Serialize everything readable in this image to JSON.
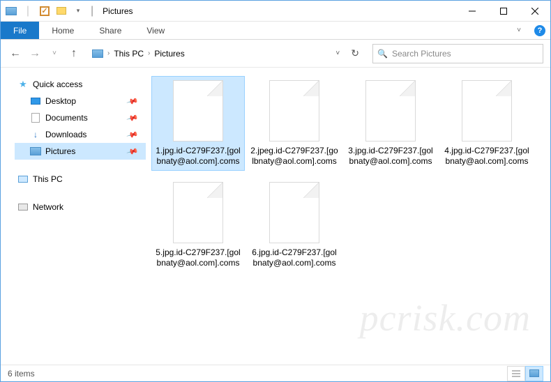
{
  "window": {
    "title": "Pictures"
  },
  "ribbon": {
    "file": "File",
    "tabs": [
      "Home",
      "Share",
      "View"
    ]
  },
  "breadcrumb": {
    "root": "This PC",
    "current": "Pictures"
  },
  "search": {
    "placeholder": "Search Pictures"
  },
  "sidebar": {
    "quick": "Quick access",
    "items": [
      {
        "label": "Desktop",
        "pinned": true
      },
      {
        "label": "Documents",
        "pinned": true
      },
      {
        "label": "Downloads",
        "pinned": true
      },
      {
        "label": "Pictures",
        "pinned": true,
        "selected": true
      }
    ],
    "thispc": "This PC",
    "network": "Network"
  },
  "files": [
    {
      "name": "1.jpg.id-C279F237.[golbnaty@aol.com].coms",
      "selected": true
    },
    {
      "name": "2.jpeg.id-C279F237.[golbnaty@aol.com].coms"
    },
    {
      "name": "3.jpg.id-C279F237.[golbnaty@aol.com].coms"
    },
    {
      "name": "4.jpg.id-C279F237.[golbnaty@aol.com].coms"
    },
    {
      "name": "5.jpg.id-C279F237.[golbnaty@aol.com].coms"
    },
    {
      "name": "6.jpg.id-C279F237.[golbnaty@aol.com].coms"
    }
  ],
  "status": {
    "count": "6 items"
  },
  "watermark": "pcrisk.com"
}
